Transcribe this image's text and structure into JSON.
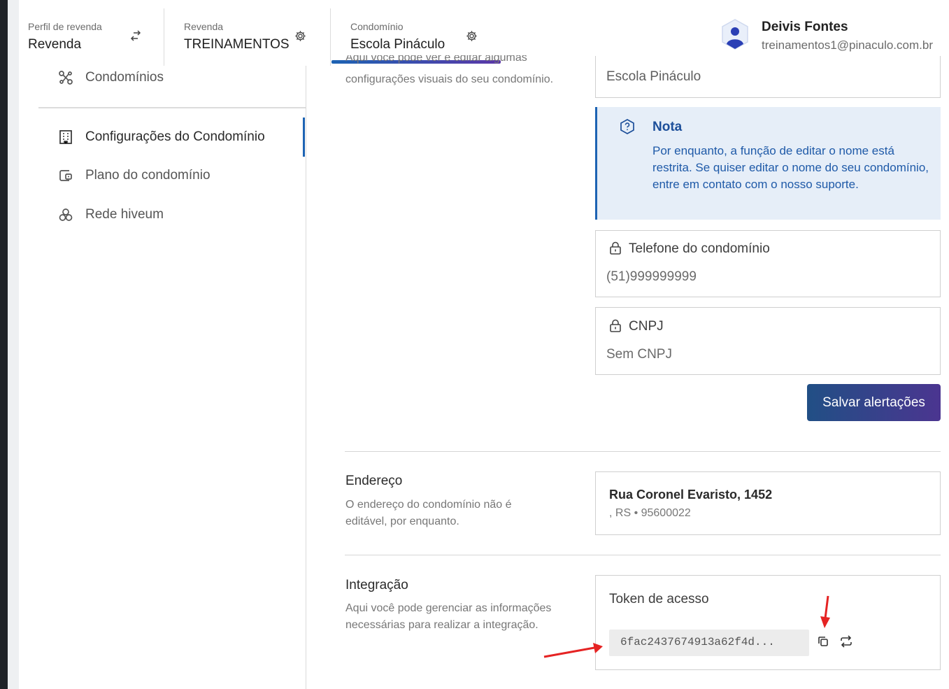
{
  "header": {
    "profile": {
      "label": "Perfil de revenda",
      "value": "Revenda"
    },
    "reseller": {
      "label": "Revenda",
      "value": "TREINAMENTOS"
    },
    "condo": {
      "label": "Condomínio",
      "value": "Escola Pináculo"
    },
    "user": {
      "name": "Deivis Fontes",
      "email": "treinamentos1@pinaculo.com.br"
    }
  },
  "sidebar": {
    "items": [
      {
        "label": "Condomínios",
        "icon": "nodes-icon"
      },
      {
        "label": "Configurações do Condomínio",
        "icon": "building-icon",
        "active": true
      },
      {
        "label": "Plano do condomínio",
        "icon": "wallet-icon"
      },
      {
        "label": "Rede hiveum",
        "icon": "hive-icon"
      }
    ]
  },
  "visual_section": {
    "description_cut": "Aqui você pode ver e editar algumas",
    "description": "configurações visuais do seu condomínio.",
    "name_value": "Escola Pináculo"
  },
  "note": {
    "title": "Nota",
    "text": "Por enquanto, a função de editar o nome está restrita. Se quiser editar o nome do seu condomínio, entre em contato com o nosso suporte."
  },
  "phone": {
    "label": "Telefone do condomínio",
    "value": "(51)999999999"
  },
  "cnpj": {
    "label": "CNPJ",
    "value": "Sem CNPJ"
  },
  "save_button": "Salvar alertações",
  "address_section": {
    "title": "Endereço",
    "description": "O endereço do condomínio não é editável, por enquanto.",
    "street": "Rua Coronel Evaristo, 1452",
    "detail": ", RS • 95600022"
  },
  "integration_section": {
    "title": "Integração",
    "description": "Aqui você pode gerenciar as informações necessárias para realizar a integração.",
    "token_label": "Token de acesso",
    "token_value": "6fac2437674913a62f4d..."
  },
  "colors": {
    "accent": "#1d63b3",
    "note_bg": "#e6eef8",
    "annotation_arrow": "#e52323"
  }
}
